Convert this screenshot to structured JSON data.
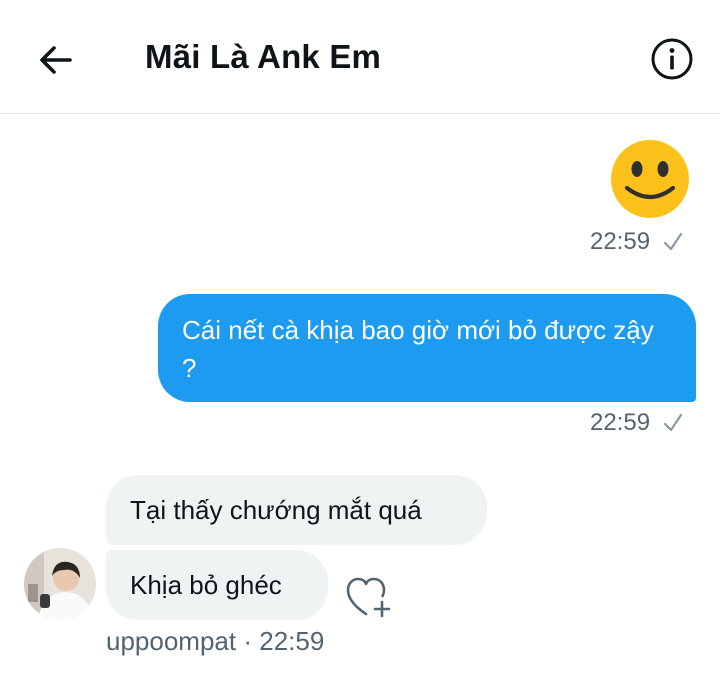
{
  "header": {
    "title": "Mãi Là Ank Em",
    "back_icon": "arrow-left-icon",
    "info_icon": "info-circle-icon"
  },
  "messages": {
    "sent": [
      {
        "content_icon": "smiley-face-emoji",
        "time": "22:59",
        "status_icon": "check-icon"
      },
      {
        "text": "Cái nết cà khịa bao giờ mới bỏ được zậy ?",
        "time": "22:59",
        "status_icon": "check-icon"
      }
    ],
    "received": [
      {
        "text": "Tại thấy chướng mắt quá"
      },
      {
        "text": "Khịa bỏ ghéc"
      }
    ],
    "received_meta": {
      "sender": "uppoompat",
      "separator": "·",
      "time": "22:59"
    }
  },
  "colors": {
    "accent": "#1d9bf0",
    "received_bubble": "#eff3f4",
    "meta_text": "#536471",
    "emoji_yellow": "#fcc21b"
  }
}
